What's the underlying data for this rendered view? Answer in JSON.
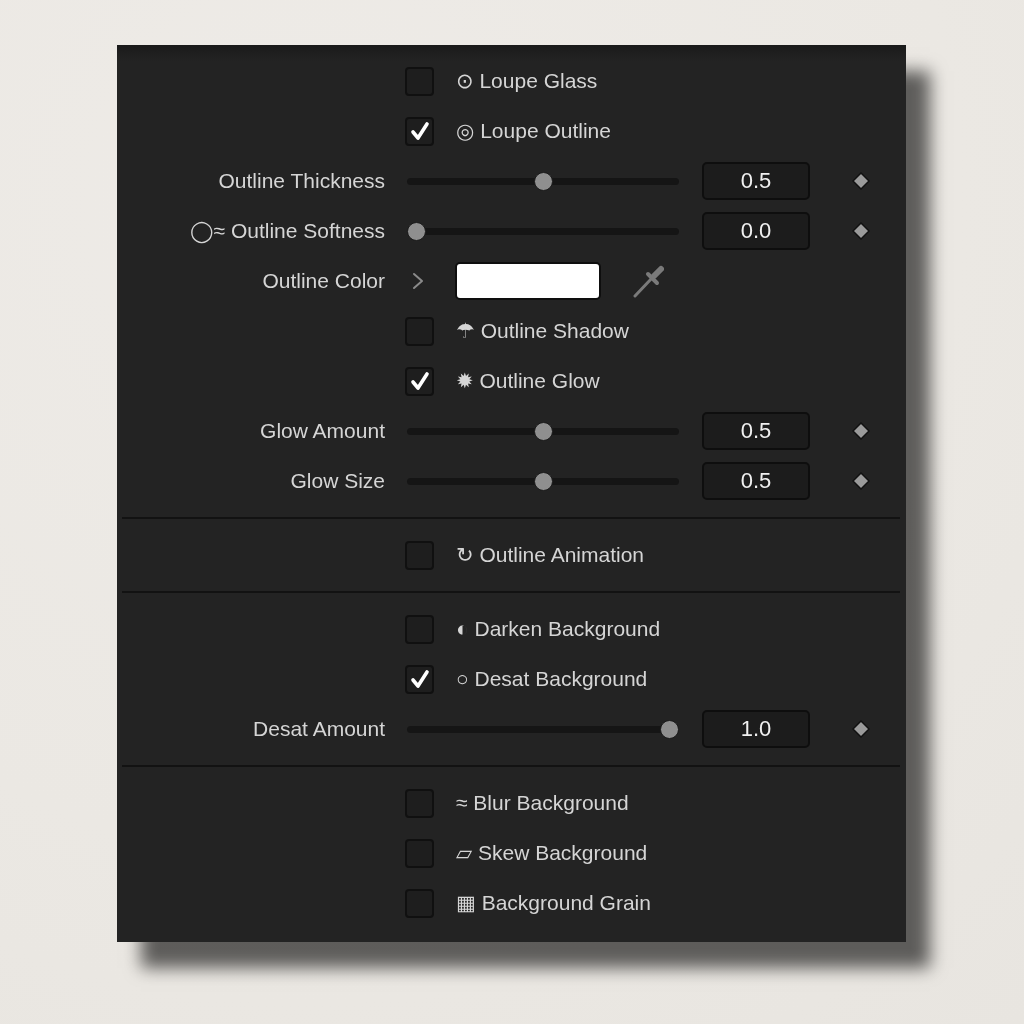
{
  "sections": [
    {
      "rows": [
        {
          "kind": "checkbox",
          "label": "⊙ Loupe Glass",
          "checked": false
        },
        {
          "kind": "checkbox",
          "label": "◎ Loupe Outline",
          "checked": true
        },
        {
          "kind": "slider",
          "label": "Outline Thickness",
          "level": 0.5,
          "value": "0.5"
        },
        {
          "kind": "slider",
          "label": "◯≈ Outline Softness",
          "level": 0,
          "value": "0.0"
        },
        {
          "kind": "color",
          "label": "Outline Color",
          "expanded": false,
          "color": "#ffffff"
        },
        {
          "kind": "checkbox",
          "label": "☂ Outline Shadow",
          "checked": false
        },
        {
          "kind": "checkbox",
          "label": "✹ Outline Glow",
          "checked": true
        },
        {
          "kind": "slider",
          "label": "Glow Amount",
          "level": 0.5,
          "value": "0.5"
        },
        {
          "kind": "slider",
          "label": "Glow Size",
          "level": 0.5,
          "value": "0.5"
        }
      ]
    },
    {
      "rows": [
        {
          "kind": "checkbox",
          "label": "↻ Outline Animation",
          "checked": false
        }
      ]
    },
    {
      "rows": [
        {
          "kind": "checkbox",
          "label": "◐ Darken Background",
          "checked": false
        },
        {
          "kind": "checkbox",
          "label": "○ Desat Background",
          "checked": true
        },
        {
          "kind": "slider",
          "label": "Desat Amount",
          "level": 1,
          "value": "1.0"
        }
      ]
    },
    {
      "rows": [
        {
          "kind": "checkbox",
          "label": "≈ Blur Background",
          "checked": false
        },
        {
          "kind": "checkbox",
          "label": "▱ Skew Background",
          "checked": false
        },
        {
          "kind": "checkbox",
          "label": "▦ Background Grain",
          "checked": false
        }
      ]
    }
  ]
}
